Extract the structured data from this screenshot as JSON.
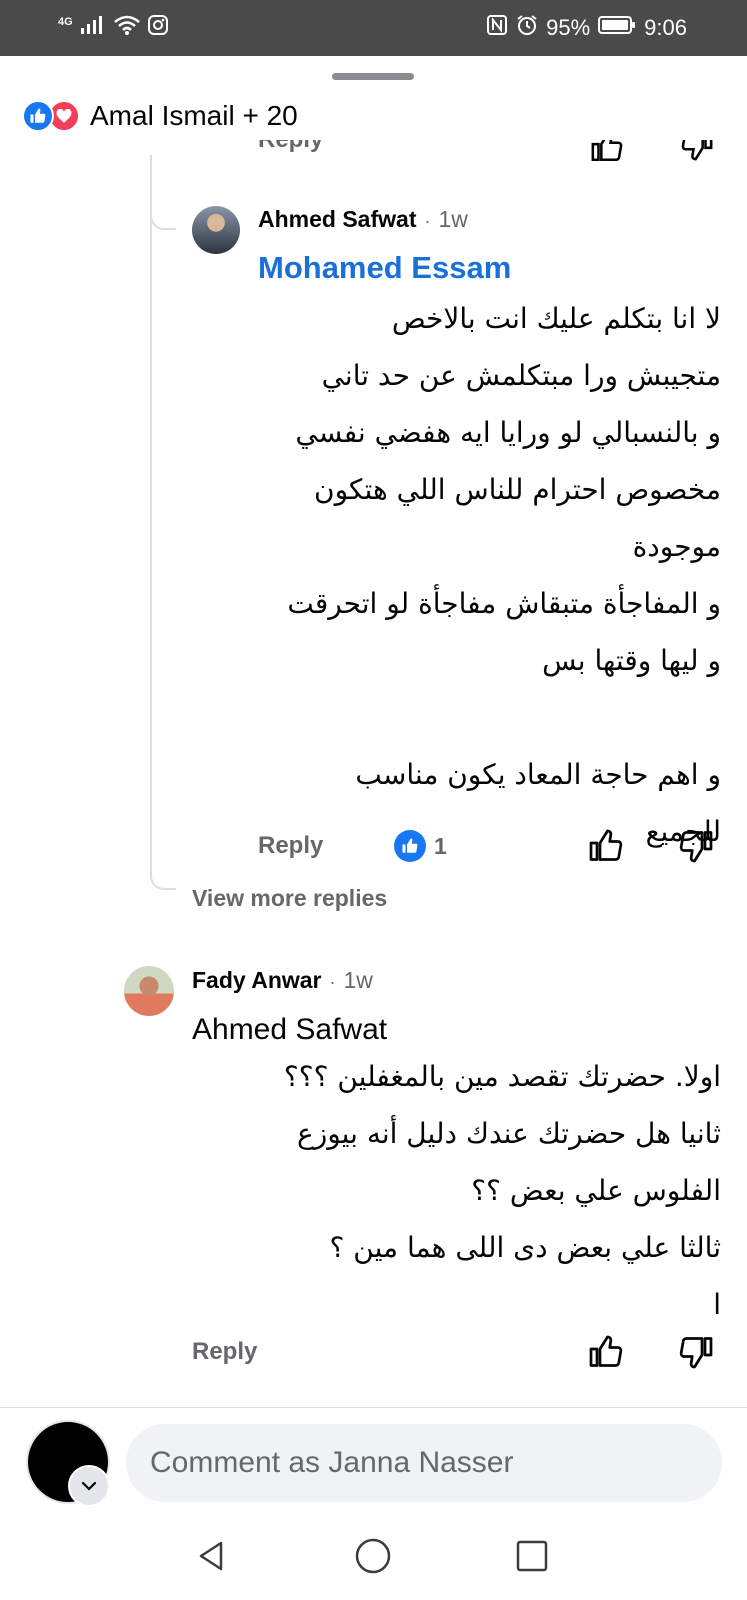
{
  "status_bar": {
    "network": "4G",
    "battery": "95%",
    "time": "9:06",
    "icons": [
      "signal-icon",
      "wifi-icon",
      "instagram-icon",
      "nfc-icon",
      "alarm-icon",
      "battery-icon"
    ]
  },
  "reactions": {
    "types": [
      "like-icon",
      "love-icon"
    ],
    "summary": "Amal Ismail + 20"
  },
  "clipped_row": {
    "reply_label": "Reply"
  },
  "reply_comment": {
    "author": "Ahmed Safwat",
    "dot": "·",
    "time": "1w",
    "mention": "Mohamed Essam",
    "lines": [
      "لا انا بتكلم عليك انت بالاخص",
      "متجيبش ورا مبتكلمش عن حد تاني",
      "و بالنسبالي لو ورايا ايه هفضي نفسي",
      "مخصوص احترام للناس اللي هتكون",
      "موجودة",
      "و المفاجأة متبقاش مفاجأة لو اتحرقت",
      "و ليها وقتها بس",
      "",
      "و اهم حاجة المعاد يكون مناسب",
      "للجميع"
    ],
    "reply_label": "Reply",
    "like_count": "1"
  },
  "view_more": "View more replies",
  "main_comment": {
    "author": "Fady Anwar",
    "dot": "·",
    "time": "1w",
    "tagged": "Ahmed Safwat",
    "lines": [
      "اولا. حضرتك تقصد مين بالمغفلين ؟؟؟",
      "ثانيا هل حضرتك عندك دليل أنه بيوزع",
      "الفلوس علي بعض ؟؟",
      "ثالثا علي بعض دى اللى هما مين ؟",
      "ا"
    ],
    "reply_label": "Reply"
  },
  "composer": {
    "placeholder": "Comment as Janna Nasser"
  },
  "nav": [
    "back-icon",
    "home-icon",
    "recents-icon"
  ],
  "colors": {
    "accent": "#1877f2",
    "mention": "#1b6fd9",
    "love": "#f33e58",
    "muted": "#65676b",
    "status_bar": "#4a4a4a"
  }
}
